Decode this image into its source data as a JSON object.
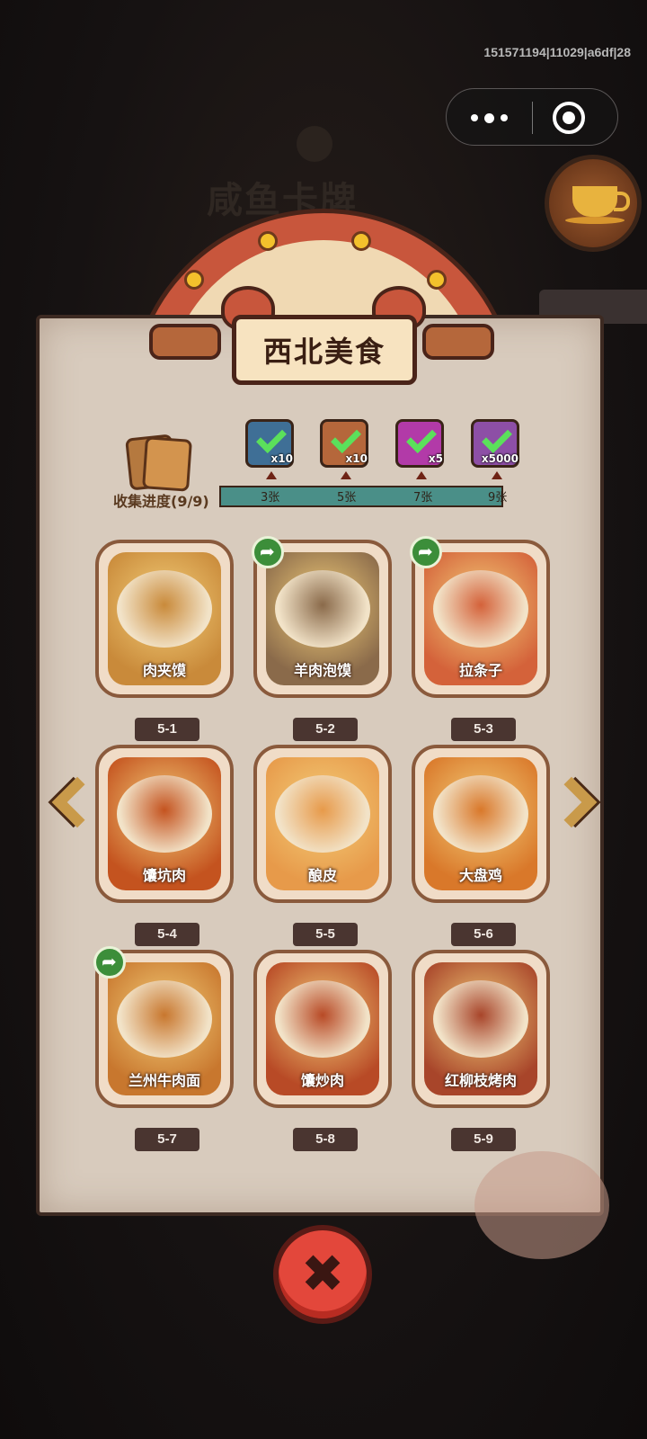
{
  "system": {
    "build_id": "151571194|11029|a6df|28"
  },
  "background": {
    "title": "咸鱼卡牌"
  },
  "capsule": {
    "more_icon": "more-dots-icon",
    "close_icon": "target-circle-icon"
  },
  "coffee_button": {
    "icon": "coffee-cup-icon"
  },
  "album": {
    "title": "西北美食",
    "collection_label": "收集进度(9/9)",
    "progress_fraction": 1.0,
    "milestones": [
      {
        "threshold": "3张",
        "reward_qty": "x10",
        "reward_icon": "tool-box-icon",
        "claimed": true,
        "color": "#3f6f96"
      },
      {
        "threshold": "5张",
        "reward_qty": "x10",
        "reward_icon": "scroll-key-icon",
        "claimed": true,
        "color": "#b5673b"
      },
      {
        "threshold": "7张",
        "reward_qty": "x5",
        "reward_icon": "gem-orb-icon",
        "claimed": true,
        "color": "#b23aa8"
      },
      {
        "threshold": "9张",
        "reward_qty": "x5000",
        "reward_icon": "silver-ingot-icon",
        "claimed": true,
        "color": "#8d4fa6"
      }
    ],
    "cards": [
      {
        "name": "肉夹馍",
        "code": "5-1",
        "shared": false,
        "color": "#c98a3a"
      },
      {
        "name": "羊肉泡馍",
        "code": "5-2",
        "shared": true,
        "color": "#8a6a4a"
      },
      {
        "name": "拉条子",
        "code": "5-3",
        "shared": true,
        "color": "#d4623a"
      },
      {
        "name": "馕坑肉",
        "code": "5-4",
        "shared": false,
        "color": "#c4531f"
      },
      {
        "name": "酿皮",
        "code": "5-5",
        "shared": false,
        "color": "#e79a4a"
      },
      {
        "name": "大盘鸡",
        "code": "5-6",
        "shared": false,
        "color": "#d9782a"
      },
      {
        "name": "兰州牛肉面",
        "code": "5-7",
        "shared": true,
        "color": "#c8772e"
      },
      {
        "name": "馕炒肉",
        "code": "5-8",
        "shared": false,
        "color": "#b84a26"
      },
      {
        "name": "红柳枝烤肉",
        "code": "5-9",
        "shared": false,
        "color": "#a8452a"
      }
    ],
    "nav": {
      "left_icon": "chevron-left-icon",
      "right_icon": "chevron-right-icon"
    },
    "close_label": "✖"
  }
}
